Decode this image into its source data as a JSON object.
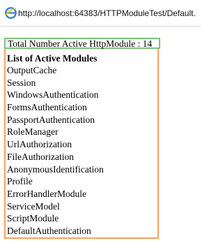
{
  "browser": {
    "url": "http://localhost:64383/HTTPModuleTest/Default...."
  },
  "summary": {
    "total_label": "Total Number Active HttpModule : 14"
  },
  "modules": {
    "heading": "List of Active Modules",
    "items": [
      "OutputCache",
      "Session",
      "WindowsAuthentication",
      "FormsAuthentication",
      "PassportAuthentication",
      "RoleManager",
      "UrlAuthorization",
      "FileAuthorization",
      "AnonymousIdentification",
      "Profile",
      "ErrorHandlerModule",
      "ServiceModel",
      "ScriptModule",
      "DefaultAuthentication"
    ]
  },
  "colors": {
    "total_border": "#7cc27c",
    "modules_border": "#f6a15c",
    "ie_icon": "#3b7dd8"
  },
  "icons": {
    "browser": "internet-explorer-icon"
  }
}
